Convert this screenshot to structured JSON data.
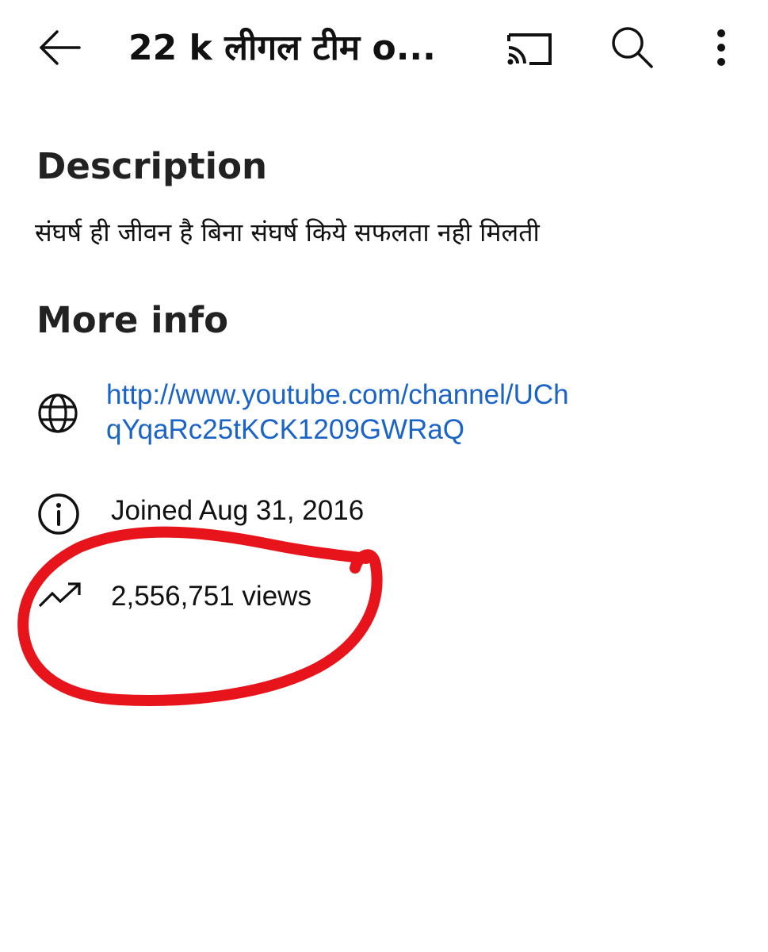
{
  "header": {
    "title": "22 k लीगल टीम o...",
    "back_icon": "arrow-left-icon",
    "cast_icon": "cast-icon",
    "search_icon": "search-icon",
    "more_icon": "more-vertical-icon"
  },
  "description": {
    "heading": "Description",
    "text": "संघर्ष ही जीवन है बिना संघर्ष किये सफलता नही मिलती"
  },
  "more_info": {
    "heading": "More info",
    "link": {
      "icon": "globe-icon",
      "text": "http://www.youtube.com/channel/UChqYqaRc25tKCK1209GWRaQ"
    },
    "joined": {
      "icon": "info-icon",
      "text": "Joined Aug 31, 2016"
    },
    "views": {
      "icon": "trending-up-icon",
      "text": "2,556,751 views"
    }
  },
  "annotation": {
    "type": "hand-drawn-circle",
    "color": "#e8141b"
  },
  "colors": {
    "link": "#1a63c9",
    "text": "#111111",
    "background": "#ffffff"
  }
}
